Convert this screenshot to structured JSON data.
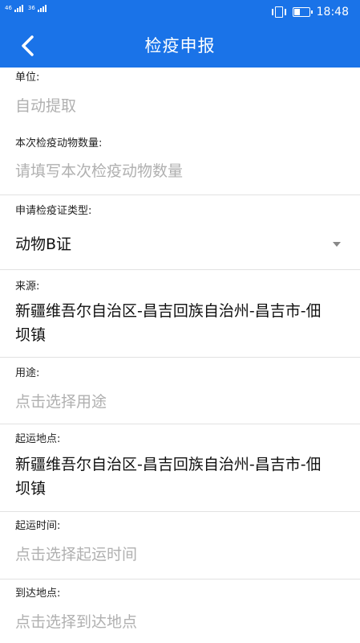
{
  "status_bar": {
    "signal1_label": "46",
    "signal2_label": "36",
    "time": "18:48"
  },
  "app_bar": {
    "title": "检疫申报",
    "back_icon": "chevron-left-icon"
  },
  "form": {
    "fields": [
      {
        "label": "单位:",
        "value": "",
        "placeholder": "自动提取"
      },
      {
        "label": "本次检疫动物数量:",
        "value": "",
        "placeholder": "请填写本次检疫动物数量"
      },
      {
        "label": "申请检疫证类型:",
        "value": "动物B证",
        "placeholder": ""
      },
      {
        "label": "来源:",
        "value": "新疆维吾尔自治区-昌吉回族自治州-昌吉市-佃坝镇",
        "placeholder": ""
      },
      {
        "label": "用途:",
        "value": "",
        "placeholder": "点击选择用途"
      },
      {
        "label": "起运地点:",
        "value": "新疆维吾尔自治区-昌吉回族自治州-昌吉市-佃坝镇",
        "placeholder": ""
      },
      {
        "label": "起运时间:",
        "value": "",
        "placeholder": "点击选择起运时间"
      },
      {
        "label": "到达地点:",
        "value": "",
        "placeholder": "点击选择到达地点"
      }
    ]
  },
  "colors": {
    "primary": "#1a73e8",
    "placeholder": "#b0b0b0",
    "divider": "#e2e2e2"
  }
}
